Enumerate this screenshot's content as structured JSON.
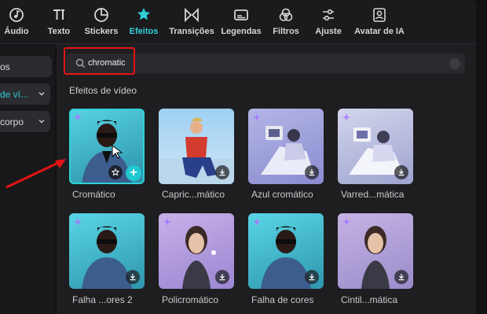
{
  "toolbar": {
    "items": [
      {
        "label": "Áudio",
        "icon": "audio-icon"
      },
      {
        "label": "Texto",
        "icon": "text-icon"
      },
      {
        "label": "Stickers",
        "icon": "stickers-icon"
      },
      {
        "label": "Efeitos",
        "icon": "effects-icon",
        "active": true
      },
      {
        "label": "Transições",
        "icon": "transitions-icon"
      },
      {
        "label": "Legendas",
        "icon": "captions-icon"
      },
      {
        "label": "Filtros",
        "icon": "filters-icon"
      },
      {
        "label": "Ajuste",
        "icon": "adjust-icon"
      },
      {
        "label": "Avatar de IA",
        "icon": "ai-avatar-icon"
      }
    ]
  },
  "sidebar": {
    "items": [
      {
        "label": "os"
      },
      {
        "label": "de ví..."
      },
      {
        "label": "corpo"
      }
    ]
  },
  "search": {
    "value": "chromatic"
  },
  "section_title": "Efeitos de vídeo",
  "effects": [
    {
      "label": "Cromático"
    },
    {
      "label": "Capric...mático"
    },
    {
      "label": "Azul cromático"
    },
    {
      "label": "Varred...mática"
    },
    {
      "label": "Falha ...ores 2"
    },
    {
      "label": "Policromático"
    },
    {
      "label": "Falha de cores"
    },
    {
      "label": "Cintil...mática"
    }
  ],
  "colors": {
    "accent": "#2fd0d8",
    "annotation": "#e31414"
  }
}
